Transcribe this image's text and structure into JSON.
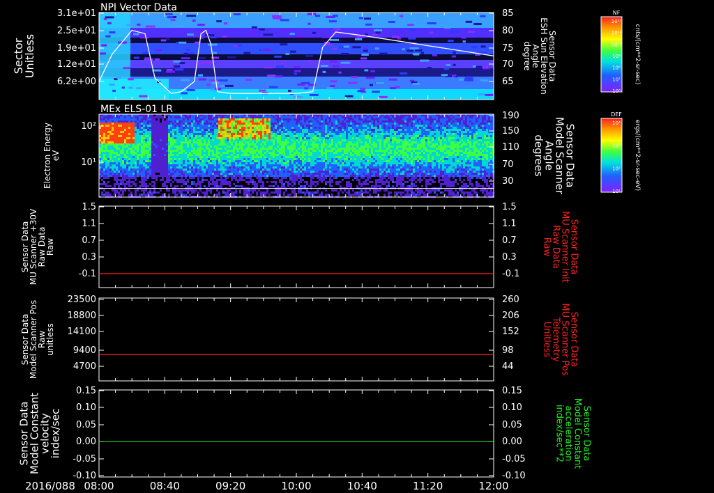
{
  "date_label": "2016/088",
  "time_ticks": [
    "08:00",
    "08:40",
    "09:20",
    "10:00",
    "10:40",
    "11:20",
    "12:00"
  ],
  "colors": {
    "axis": "#ffffff",
    "red_trace": "#ff2020",
    "green_trace": "#22dd22",
    "red_label": "#ff2222",
    "green_label": "#22ee22"
  },
  "panels": [
    {
      "id": "npi",
      "title": "NPI Vector Data",
      "left_label": [
        "Sector",
        "Unitless"
      ],
      "left_ticks": [
        "3.1e+01",
        "2.5e+01",
        "1.9e+01",
        "1.2e+01",
        "6.2e+00"
      ],
      "right_label": [
        "Sensor Data",
        "ESH Sun Elevation",
        "Angle",
        "degree"
      ],
      "right_ticks": [
        "85",
        "80",
        "75",
        "70",
        "65"
      ],
      "colorbar": {
        "label": "NF",
        "unit": "cnts/(cm**2-sr-sec)",
        "ticks": [
          "10¹²",
          "10¹¹",
          "10¹⁰",
          "10⁹",
          "10⁸",
          "10⁷",
          "10⁶"
        ]
      }
    },
    {
      "id": "els",
      "title": "MEx ELS-01 LR",
      "left_label": [
        "Electron Energy",
        "eV"
      ],
      "left_ticks": [
        "10²",
        "10¹"
      ],
      "right_label": [
        "Sensor Data",
        "Model Scanner",
        "Angle",
        "degrees"
      ],
      "right_ticks": [
        "190",
        "150",
        "110",
        "70",
        "30"
      ],
      "colorbar": {
        "label": "DEF",
        "unit": "ergs/(cm**2-sr-sec-eV)",
        "ticks": [
          "10⁴",
          "10³",
          "10²",
          "10¹"
        ]
      }
    },
    {
      "id": "mu-raw",
      "left_label": [
        "Sensor Data",
        "MU Scanner +30V",
        "Raw Data",
        "Raw"
      ],
      "left_ticks": [
        "1.5",
        "1.1",
        "0.7",
        "0.3",
        "-0.1"
      ],
      "right_label": [
        "Sensor Data",
        "MU Scanner Init",
        "Raw Data",
        "Raw"
      ],
      "right_ticks": [
        "1.5",
        "1.1",
        "0.7",
        "0.3",
        "-0.1"
      ]
    },
    {
      "id": "mu-pos",
      "left_label": [
        "Sensor Data",
        "Model Scanner Pos",
        "Raw",
        "unitless"
      ],
      "left_ticks": [
        "23500",
        "18800",
        "14100",
        "9400",
        "4700"
      ],
      "right_label": [
        "Sensor Data",
        "MU Scanner Pos",
        "Telemetry",
        "Unitless"
      ],
      "right_ticks": [
        "260",
        "206",
        "152",
        "98",
        "44"
      ]
    },
    {
      "id": "const",
      "left_label": [
        "Sensor Data",
        "Model Constant",
        "velocity",
        "index/sec"
      ],
      "left_ticks": [
        "0.15",
        "0.10",
        "0.05",
        "0.00",
        "-0.05",
        "-0.10"
      ],
      "right_label": [
        "Sensor Data",
        "Model Constant",
        "acceleration",
        "index/sec**2"
      ],
      "right_ticks": [
        "0.15",
        "0.10",
        "0.05",
        "0.00",
        "-0.05",
        "-0.10"
      ]
    }
  ],
  "chart_data": [
    {
      "type": "heatmap",
      "title": "NPI Vector Data",
      "ylabel": "Sector Unitless",
      "y2label": "Sensor Data ESH Sun Elevation Angle degree",
      "x_range": [
        "08:00",
        "12:00"
      ],
      "y2lim": [
        61,
        85
      ],
      "colorbar_label": "NF cnts/(cm**2-sr-sec)",
      "overlay_line": {
        "name": "",
        "x": [
          "08:00",
          "08:08",
          "08:20",
          "08:28",
          "08:34",
          "08:44",
          "08:50",
          "08:58",
          "09:02",
          "09:05",
          "09:08",
          "09:12",
          "09:20",
          "09:40",
          "10:00",
          "10:10",
          "10:16",
          "10:24",
          "10:40",
          "11:00",
          "11:20",
          "11:40",
          "12:00"
        ],
        "y": [
          65,
          73,
          80,
          79,
          66,
          61.5,
          62,
          65,
          79,
          80,
          76,
          62,
          61.5,
          61.5,
          61.5,
          62,
          75,
          79.5,
          78.5,
          77,
          75.5,
          74,
          72.5
        ]
      }
    },
    {
      "type": "heatmap",
      "title": "MEx ELS-01 LR",
      "ylabel": "Electron Energy eV",
      "y2label": "Sensor Data Model Scanner Angle degrees",
      "x_range": [
        "08:00",
        "12:00"
      ],
      "yscale": "log",
      "y2lim": [
        10,
        190
      ],
      "colorbar_label": "DEF ergs/(cm**2-sr-sec-eV)",
      "overlay_line": {
        "name": "",
        "x": [
          "08:00",
          "12:00"
        ],
        "y": [
          12,
          12
        ]
      }
    },
    {
      "type": "line",
      "ylabel": "Sensor Data MU Scanner +30V Raw Data Raw",
      "y2label": "Sensor Data MU Scanner Init Raw Data Raw",
      "ylim": [
        -0.3,
        1.5
      ],
      "series": [
        {
          "x": [
            "08:00",
            "12:00"
          ],
          "values": [
            -0.1,
            -0.1
          ],
          "color": "#ff2020"
        }
      ]
    },
    {
      "type": "line",
      "ylabel": "Sensor Data Model Scanner Pos Raw unitless",
      "y2label": "Sensor Data MU Scanner Pos Telemetry Unitless",
      "ylim": [
        0,
        23500
      ],
      "series": [
        {
          "x": [
            "08:00",
            "12:00"
          ],
          "values": [
            8000,
            8000
          ],
          "color": "#ff2020"
        }
      ]
    },
    {
      "type": "line",
      "ylabel": "Sensor Data Model Constant velocity index/sec",
      "y2label": "Sensor Data Model Constant acceleration index/sec**2",
      "ylim": [
        -0.1,
        0.15
      ],
      "series": [
        {
          "x": [
            "08:00",
            "12:00"
          ],
          "values": [
            0.0,
            0.0
          ],
          "color": "#22dd22"
        }
      ]
    }
  ]
}
